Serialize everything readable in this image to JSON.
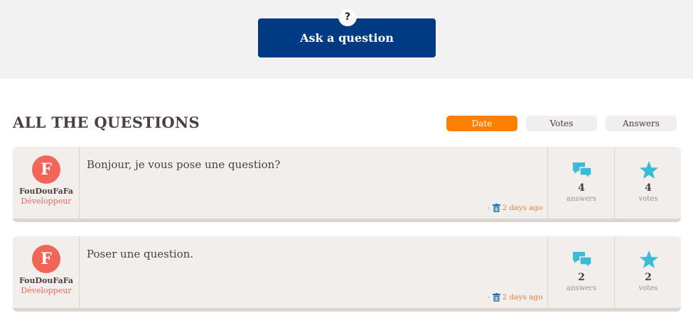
{
  "header": {
    "badge": "?",
    "ask_label": "Ask a question"
  },
  "questions_section": {
    "title": "ALL THE QUESTIONS",
    "sort": {
      "date": "Date",
      "votes": "Votes",
      "answers": "Answers",
      "active": "Date"
    }
  },
  "questions": [
    {
      "avatar_letter": "F",
      "author": "FouDouFaFa",
      "role": "Développeur",
      "title": "Bonjour, je vous pose une question?",
      "dash": "-",
      "time": "2 days ago",
      "answers_count": "4",
      "answers_label": "answers",
      "votes_count": "4",
      "votes_label": "votes"
    },
    {
      "avatar_letter": "F",
      "author": "FouDouFaFa",
      "role": "Développeur",
      "title": "Poser une question.",
      "dash": "-",
      "time": "2 days ago",
      "answers_count": "2",
      "answers_label": "answers",
      "votes_count": "2",
      "votes_label": "votes"
    }
  ],
  "colors": {
    "primary": "#003a82",
    "accent": "#ff8000",
    "avatar": "#f2665a",
    "stat_icon": "#3bbcd6",
    "card_bg": "#f2eeec"
  },
  "icons": {
    "badge": "question-icon",
    "answers": "chat-bubbles-icon",
    "votes": "star-icon",
    "delete": "trash-icon"
  }
}
